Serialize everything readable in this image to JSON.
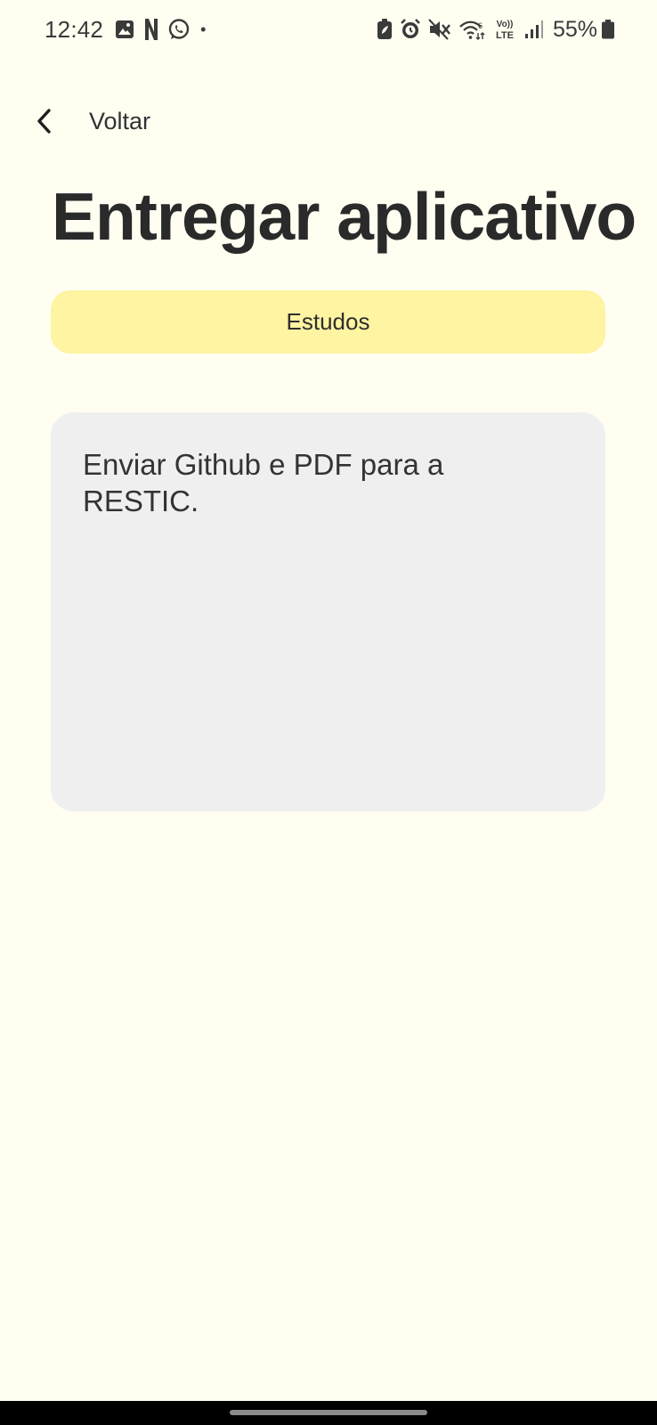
{
  "status_bar": {
    "time": "12:42",
    "left_icons": [
      "gallery-icon",
      "netflix-icon",
      "whatsapp-icon"
    ],
    "dot": "•",
    "right_icons": [
      "battery-saver-icon",
      "alarm-icon",
      "mute-icon",
      "wifi-icon",
      "volte-icon",
      "signal-icon"
    ],
    "volte_label_top": "Vo))",
    "volte_label_bottom": "LTE",
    "battery_percent": "55%"
  },
  "header": {
    "back_label": "Voltar"
  },
  "task": {
    "title": "Entregar aplicativo",
    "category": "Estudos",
    "category_color": "#fef4a1",
    "description": "Enviar Github e PDF para a\nRESTIC."
  },
  "theme": {
    "background": "#fffef1",
    "card_background": "#efeff0"
  }
}
